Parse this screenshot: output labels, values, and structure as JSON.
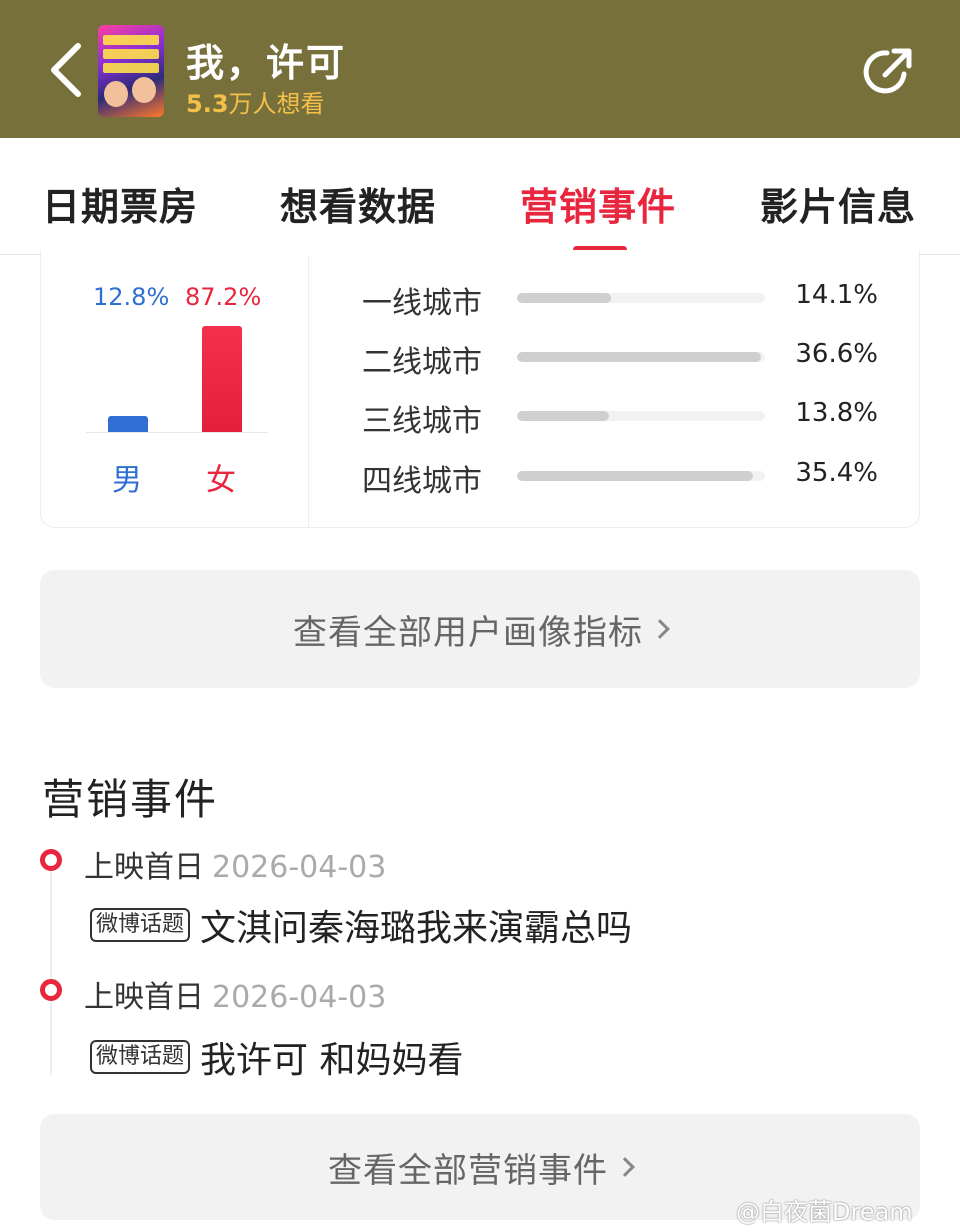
{
  "header": {
    "title": "我，许可",
    "want_count": "5.3",
    "want_suffix": "万人想看"
  },
  "tabs": [
    {
      "label": "日期票房",
      "active": false
    },
    {
      "label": "想看数据",
      "active": false
    },
    {
      "label": "营销事件",
      "active": true
    },
    {
      "label": "影片信息",
      "active": false
    }
  ],
  "gender": {
    "male": {
      "label": "男",
      "percent_text": "12.8%",
      "percent": 12.8
    },
    "female": {
      "label": "女",
      "percent_text": "87.2%",
      "percent": 87.2
    }
  },
  "cities": [
    {
      "name": "一线城市",
      "value_text": "14.1%",
      "value": 14.1
    },
    {
      "name": "二线城市",
      "value_text": "36.6%",
      "value": 36.6
    },
    {
      "name": "三线城市",
      "value_text": "13.8%",
      "value": 13.8
    },
    {
      "name": "四线城市",
      "value_text": "35.4%",
      "value": 35.4
    }
  ],
  "profile_button": "查看全部用户画像指标",
  "events_section": {
    "title": "营销事件",
    "items": [
      {
        "type": "上映首日",
        "date": "2026-04-03",
        "tag": "微博话题",
        "text": "文淇问秦海璐我来演霸总吗"
      },
      {
        "type": "上映首日",
        "date": "2026-04-03",
        "tag": "微博话题",
        "text": "我许可 和妈妈看"
      }
    ]
  },
  "events_button": "查看全部营销事件",
  "watermark": "@白夜菌Dream",
  "colors": {
    "header_bg": "#77703b",
    "accent": "#e8263e",
    "male": "#2f6fd3",
    "want": "#f5c04a"
  }
}
